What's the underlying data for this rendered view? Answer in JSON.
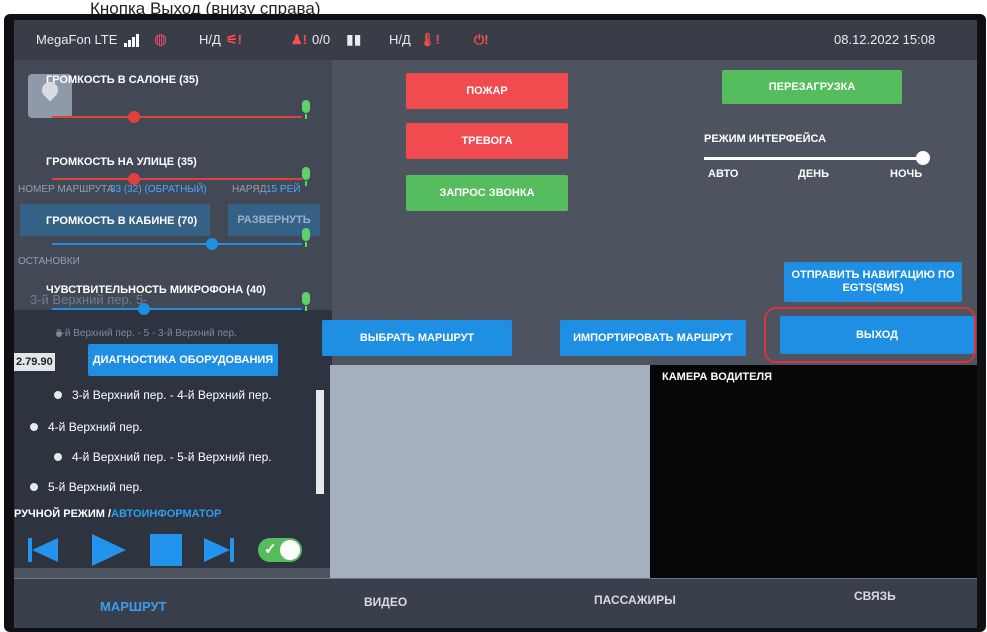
{
  "caption": "Кнопка Выход (внизу справа)",
  "status": {
    "carrier": "MegaFon LTE",
    "gps": "Н/Д",
    "passengers": "0/0",
    "temp": "Н/Д",
    "datetime": "08.12.2022  15:08"
  },
  "sliders": [
    {
      "label": "ГРОМКОСТЬ В САЛОНЕ (35)",
      "value": 35,
      "color": "#e0403e"
    },
    {
      "label": "ГРОМКОСТЬ НА УЛИЦЕ (35)",
      "value": 35,
      "color": "#e0403e"
    },
    {
      "label": "ГРОМКОСТЬ В КАБИНЕ (70)",
      "value": 70,
      "color": "#1f8fe4"
    },
    {
      "label": "ЧУВСТВИТЕЛЬНОСТЬ МИКРОФОНА (40)",
      "value": 40,
      "color": "#1f8fe4"
    }
  ],
  "route_info": {
    "route_no_label": "НОМЕР МАРШРУТА",
    "route_no_value": "33 (32) (ОБРАТНЫЙ)",
    "shift_label": "НАРЯД",
    "shift_value": "15 РЕЙ",
    "expand_button": "РАЗВЕРНУТЬ",
    "stops_label": "ОСТАНОВКИ",
    "faded_stop": "3-й Верхний пер. 5-",
    "faded_segment": "3-й Верхний пер. - 5 - 3-й Верхний пер.",
    "distance": "2.79.90"
  },
  "stops": [
    "3-й Верхний пер. - 4-й Верхний пер.",
    "4-й Верхний пер.",
    "4-й Верхний пер. - 5-й Верхний пер.",
    "5-й Верхний пер."
  ],
  "mode": {
    "manual": "РУЧНОЙ РЕЖИМ /",
    "auto": "АВТОИНФОРМАТОР",
    "toggle_on": true
  },
  "buttons": {
    "diagnostics": "ДИАГНОСТИКА ОБОРУДОВАНИЯ",
    "fire": "ПОЖАР",
    "alarm": "ТРЕВОГА",
    "call": "ЗАПРОС ЗВОНКА",
    "reboot": "ПЕРЕЗАГРУЗКА",
    "send_nav": "ОТПРАВИТЬ НАВИГАЦИЮ ПО EGTS(SMS)",
    "select_route": "ВЫБРАТЬ МАРШРУТ",
    "import_route": "ИМПОРТИРОВАТЬ МАРШРУТ",
    "exit": "ВЫХОД"
  },
  "interface_mode": {
    "title": "РЕЖИМ ИНТЕРФЕЙСА",
    "options": [
      "АВТО",
      "ДЕНЬ",
      "НОЧЬ"
    ],
    "selected": "НОЧЬ"
  },
  "camera_label": "КАМЕРА ВОДИТЕЛЯ",
  "tabs": [
    "МАРШРУТ",
    "ВИДЕО",
    "ПАССАЖИРЫ",
    "СВЯЗЬ"
  ],
  "colors": {
    "accent": "#1f8fe4",
    "danger": "#f04b4e",
    "ok": "#56bd5f",
    "highlight": "#e03040"
  }
}
